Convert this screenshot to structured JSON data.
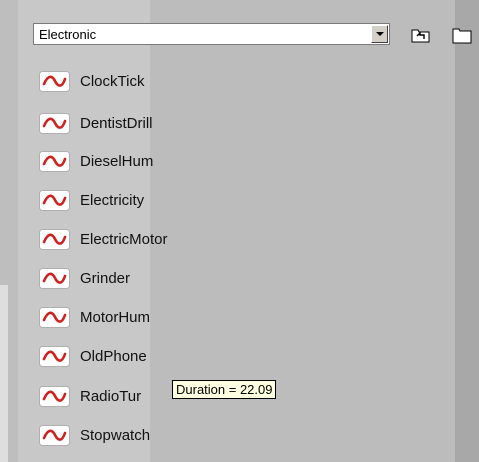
{
  "category_select": {
    "value": "Electronic"
  },
  "toolbar": {
    "up_icon": "up-folder-icon",
    "new_folder_icon": "new-folder-icon"
  },
  "sounds": [
    {
      "label": "ClockTick"
    },
    {
      "label": "DentistDrill"
    },
    {
      "label": "DieselHum"
    },
    {
      "label": "Electricity"
    },
    {
      "label": "ElectricMotor"
    },
    {
      "label": "Grinder"
    },
    {
      "label": "MotorHum"
    },
    {
      "label": "OldPhone"
    },
    {
      "label": "RadioTur"
    },
    {
      "label": "Stopwatch"
    }
  ],
  "tooltip": {
    "text": "Duration = 22.09"
  },
  "colors": {
    "wave_icon": "#cc2222",
    "panel_bg": "#c8c8c8",
    "tooltip_bg": "#ffffe1"
  }
}
